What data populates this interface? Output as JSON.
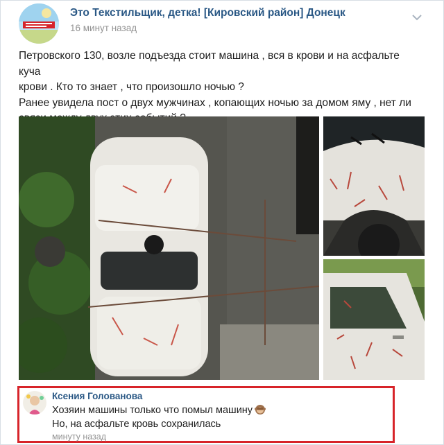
{
  "post": {
    "group_name": "Это Текстильщик, детка! [Кировский район] Донецк",
    "time": "16 минут назад",
    "text_lines": [
      "Петровского 130, возле подъезда стоит машина , вся в крови и на асфальте куча",
      "крови . Кто то знает , что произошло ночью ?",
      "Ранее увидела пост о двух мужчинах , копающих ночью за домом яму , нет ли",
      "связи между двух этих событий ?"
    ]
  },
  "photos": [
    {
      "label": "car-top-view"
    },
    {
      "label": "car-hood-closeup"
    },
    {
      "label": "car-door-closeup"
    }
  ],
  "comment": {
    "author": "Ксения Голованова",
    "text_lines": [
      "Хозяин машины только что помыл машину",
      "Но, на асфальте кровь сохранилась"
    ],
    "emoji": "see-no-evil-monkey-icon",
    "time": "минуту назад"
  },
  "colors": {
    "link": "#2a5885",
    "muted": "#939393",
    "highlight": "#d7242a"
  }
}
